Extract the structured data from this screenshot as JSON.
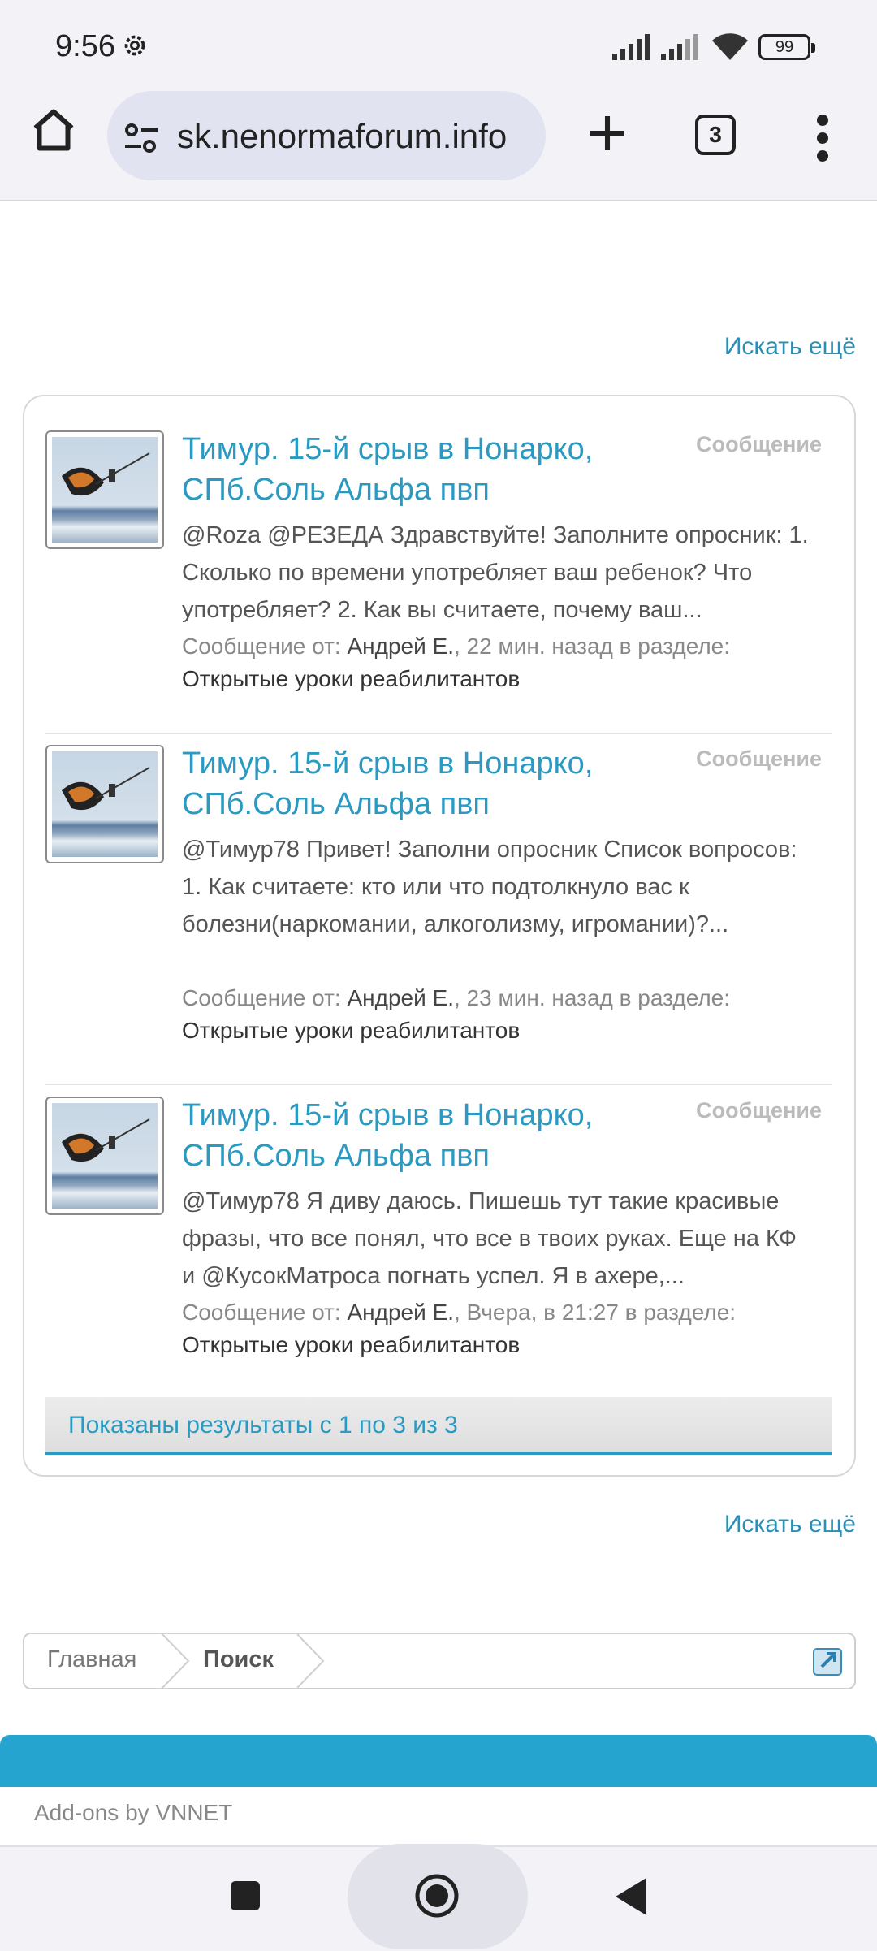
{
  "status_bar": {
    "time": "9:56",
    "battery": "99"
  },
  "browser": {
    "url": "sk.nenormaforum.info",
    "tab_count": "3"
  },
  "search_more_label": "Искать ещё",
  "results": [
    {
      "title": "Тимур. 15-й срыв в Нонарко, СПб.Соль Альфа пвп",
      "type": "Сообщение",
      "snippet": "@Roza @РЕЗЕДА Здравствуйте! Заполните опросник: 1. Сколько по времени употребляет ваш ребенок? Что употребляет? 2. Как вы считаете, почему ваш...",
      "meta_prefix": "Сообщение от:",
      "author": "Андрей Е.",
      "time": ", 22 мин. назад в разделе:",
      "section": "Открытые уроки реабилитантов"
    },
    {
      "title": "Тимур. 15-й срыв в Нонарко, СПб.Соль Альфа пвп",
      "type": "Сообщение",
      "snippet": "@Тимур78 Привет! Заполни опросник Список вопросов: 1. Как считаете: кто или что подтолкнуло вас к болезни(наркомании, алкоголизму, игромании)?...",
      "meta_prefix": "Сообщение от:",
      "author": "Андрей Е.",
      "time": ", 23 мин. назад в разделе:",
      "section": "Открытые уроки реабилитантов"
    },
    {
      "title": "Тимур. 15-й срыв в Нонарко, СПб.Соль Альфа пвп",
      "type": "Сообщение",
      "snippet": "@Тимур78 Я диву даюсь. Пишешь тут такие красивые фразы, что все понял, что все в твоих руках. Еще на КФ и @КусокМатроса погнать успел. Я в ахере,...",
      "meta_prefix": "Сообщение от:",
      "author": "Андрей Е.",
      "time": ", Вчера, в 21:27 в разделе:",
      "section": "Открытые уроки реабилитантов"
    }
  ],
  "results_footer": "Показаны результаты с 1 по 3 из 3",
  "breadcrumb": {
    "home": "Главная",
    "current": "Поиск"
  },
  "footer": {
    "addons": "Add-ons by VNNET"
  },
  "colors": {
    "link": "#2a9ac2",
    "band": "#25a4d0"
  }
}
